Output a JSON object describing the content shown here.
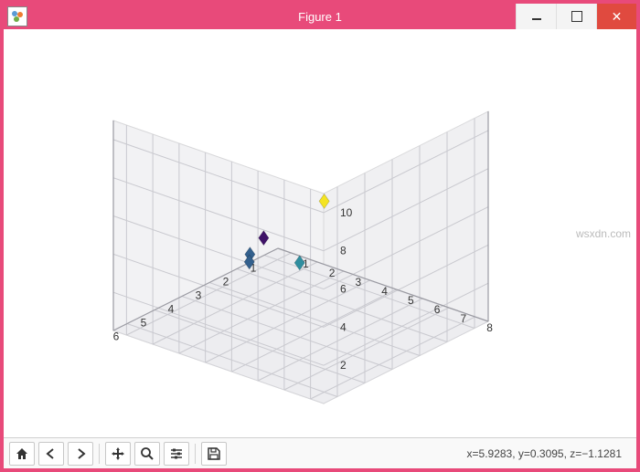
{
  "window": {
    "title": "Figure 1"
  },
  "toolbar": {
    "home": "Home",
    "back": "Back",
    "forward": "Forward",
    "pan": "Pan",
    "zoom": "Zoom",
    "configure": "Configure subplots",
    "save": "Save"
  },
  "status": {
    "text": "x=5.9283, y=0.3095, z=−1.1281"
  },
  "watermark": "wsxdn.com",
  "chart_data": {
    "type": "scatter",
    "dimensions": 3,
    "marker": "diamond",
    "x_ticks": [
      1,
      2,
      3,
      4,
      5,
      6
    ],
    "y_ticks": [
      1,
      2,
      3,
      4,
      5,
      6,
      7,
      8
    ],
    "z_ticks": [
      2,
      4,
      6,
      8,
      10
    ],
    "xlim": [
      0.5,
      6.5
    ],
    "ylim": [
      0.5,
      8.5
    ],
    "zlim": [
      0,
      11
    ],
    "points": [
      {
        "x": 1.5,
        "y": 1.0,
        "z": 1.5,
        "color": "#3f1268"
      },
      {
        "x": 2.0,
        "y": 1.0,
        "z": 1.0,
        "color": "#33608d"
      },
      {
        "x": 2.5,
        "y": 1.5,
        "z": 1.2,
        "color": "#33608d"
      },
      {
        "x": 4.5,
        "y": 5.5,
        "z": 4.5,
        "color": "#2f8e9f"
      },
      {
        "x": 6.0,
        "y": 8.0,
        "z": 10.0,
        "color": "#f4e422"
      }
    ],
    "title": "",
    "xlabel": "",
    "ylabel": "",
    "zlabel": ""
  }
}
